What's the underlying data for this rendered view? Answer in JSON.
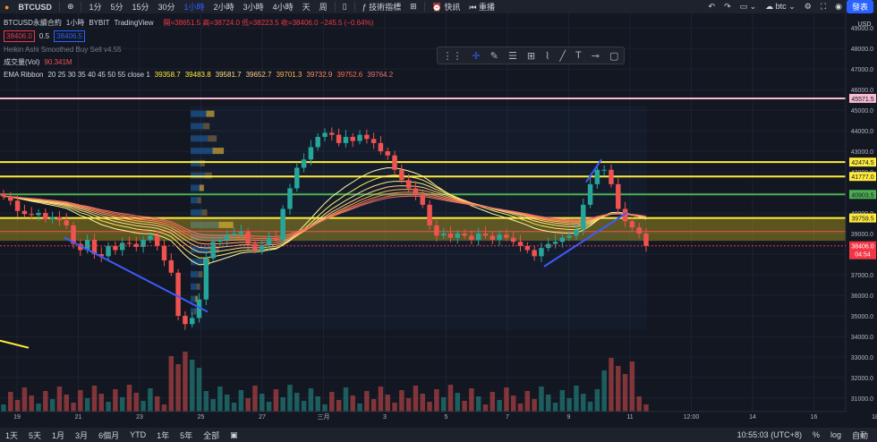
{
  "topbar": {
    "symbol": "BTCUSD",
    "add_icon": "plus-circle-icon",
    "intervals": [
      "1分",
      "5分",
      "15分",
      "30分",
      "1小時",
      "2小時",
      "3小時",
      "4小時",
      "天",
      "周"
    ],
    "active_interval": "1小時",
    "indicators_label": "技術指標",
    "quick_label": "快訊",
    "replay_label": "重播",
    "compare_value": "btc",
    "publish_label": "發表"
  },
  "legend": {
    "title": "BTCUSD永續合約",
    "interval": "1小時",
    "exchange": "BYBIT",
    "source": "TradingView",
    "ohlc": "開=38651.5 高=38724.0 低=38223.5 收=38406.0 −245.5 (−0.64%)",
    "bid": "38406.0",
    "spread": "0.5",
    "ask": "38406.5",
    "heikin": "Heikin Ashi Smoothed Buy Sell v4.55",
    "vol_label": "成交量(Vol)",
    "vol_value": "90.341M",
    "ema_label": "EMA Ribbon",
    "ema_params": "20 25 30 35 40 45 50 55 close 1",
    "ema_values": [
      "39358.7",
      "39483.8",
      "39581.7",
      "39652.7",
      "39701.3",
      "39732.9",
      "39752.6",
      "39764.2"
    ]
  },
  "bottombar": {
    "ranges": [
      "1天",
      "5天",
      "1月",
      "3月",
      "6個月",
      "YTD",
      "1年",
      "5年",
      "全部"
    ],
    "time": "10:55:03 (UTC+8)",
    "percent": "%",
    "log": "log",
    "auto": "自動"
  },
  "chart_data": {
    "type": "candlestick",
    "symbol": "BTCUSD",
    "currency": "USD",
    "y_ticks": [
      49000,
      48000,
      47000,
      46000,
      45000,
      44000,
      43000,
      42000,
      41000,
      40000,
      39000,
      38000,
      37000,
      36000,
      35000,
      34000,
      33000,
      32000,
      31000
    ],
    "y_range": [
      30350,
      49700
    ],
    "x_ticks": [
      "19",
      "21",
      "23",
      "25",
      "27",
      "三月",
      "3",
      "5",
      "7",
      "9",
      "11",
      "12:00",
      "14",
      "16",
      "18"
    ],
    "horizontal_lines": [
      {
        "price": 45571.5,
        "label": "45571.5",
        "color": "#f8bbd0"
      },
      {
        "price": 42474.5,
        "label": "42474.5",
        "color": "#ffeb3b"
      },
      {
        "price": 41777.0,
        "label": "41777.0",
        "color": "#ffeb3b"
      },
      {
        "price": 40903.5,
        "label": "40903.5",
        "color": "#4caf50"
      },
      {
        "price": 39759.5,
        "label": "39759.5",
        "color": "#ffeb3b"
      }
    ],
    "last_price": {
      "price": 38406.0,
      "label": "38406.0",
      "countdown": "04:54",
      "color": "#f23645"
    },
    "colors": {
      "up": "#26a69a",
      "down": "#ef5350",
      "ribbon": "#f5d76e",
      "trend": "#3d5afe",
      "zone": "#e6c619"
    },
    "close": [
      40800,
      40600,
      40100,
      39950,
      39900,
      40000,
      39700,
      39800,
      39650,
      39400,
      38500,
      38200,
      38700,
      38000,
      37900,
      38400,
      38200,
      38550,
      38500,
      38350,
      38700,
      38900,
      38400,
      37700,
      37100,
      35000,
      34600,
      34900,
      35800,
      37800,
      38600,
      38700,
      38900,
      39000,
      39100,
      38500,
      38200,
      38450,
      38800,
      38700,
      40200,
      41200,
      42200,
      42600,
      43200,
      43700,
      43900,
      43800,
      43400,
      43700,
      43500,
      43800,
      43600,
      43400,
      43000,
      42800,
      42100,
      41600,
      41200,
      40900,
      40400,
      39400,
      38900,
      39000,
      38800,
      39000,
      38900,
      38700,
      39000,
      38900,
      38700,
      38950,
      38800,
      38600,
      38400,
      38200,
      37900,
      38300,
      38500,
      38600,
      38800,
      38900,
      39200,
      40400,
      41400,
      42100,
      42100,
      41400,
      40200,
      39600,
      39300,
      39000,
      38400
    ]
  }
}
